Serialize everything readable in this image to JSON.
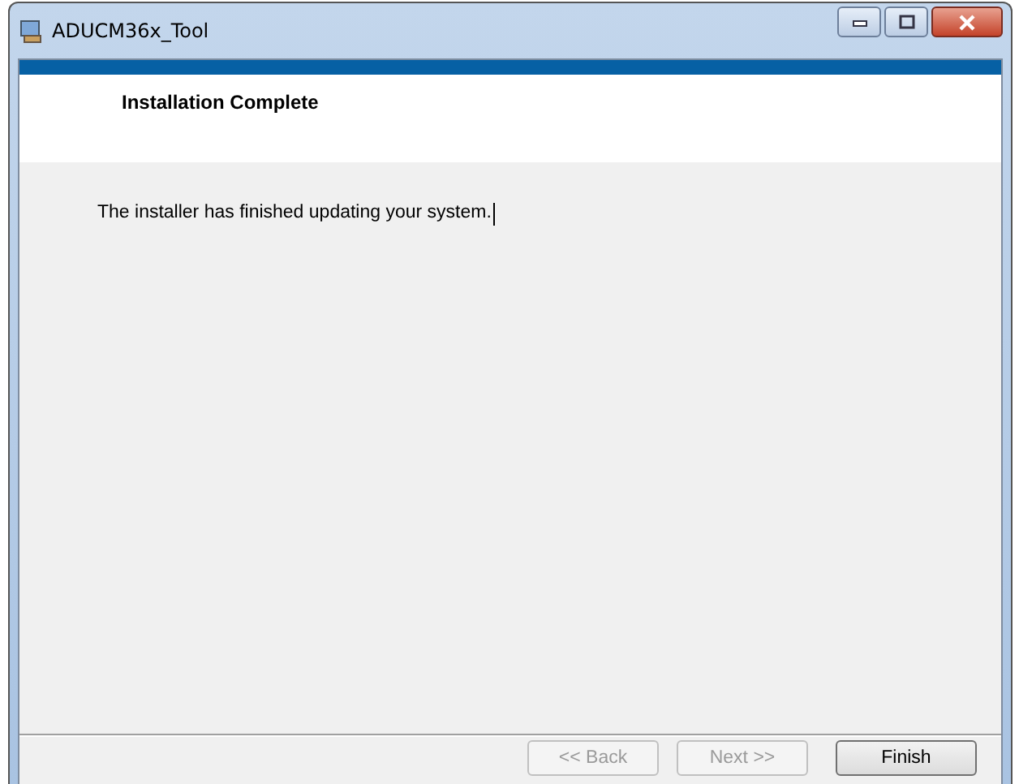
{
  "window": {
    "title": "ADUCM36x_Tool"
  },
  "header": {
    "title": "Installation Complete"
  },
  "message": "The installer has finished updating your system.",
  "buttons": [
    {
      "label": "<< Back",
      "disabled": true
    },
    {
      "label": "Next >>",
      "disabled": true
    },
    {
      "label": "Finish",
      "disabled": false
    }
  ]
}
